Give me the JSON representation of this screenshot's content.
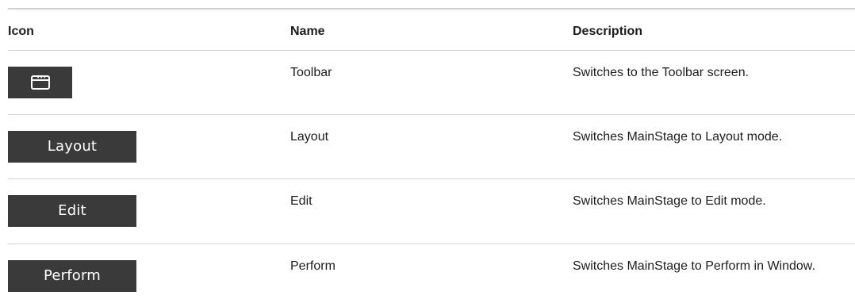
{
  "table": {
    "headers": {
      "icon": "Icon",
      "name": "Name",
      "description": "Description"
    },
    "rows": [
      {
        "icon_name": "toolbar-window-icon",
        "icon_label": "",
        "name": "Toolbar",
        "description": "Switches to the Toolbar screen."
      },
      {
        "icon_name": "layout-button-image",
        "icon_label": "Layout",
        "name": "Layout",
        "description": "Switches MainStage to Layout mode."
      },
      {
        "icon_name": "edit-button-image",
        "icon_label": "Edit",
        "name": "Edit",
        "description": "Switches MainStage to Edit mode."
      },
      {
        "icon_name": "perform-button-image",
        "icon_label": "Perform",
        "name": "Perform",
        "description": "Switches MainStage to Perform in Window."
      }
    ]
  },
  "colors": {
    "button_background": "#3a3a3a",
    "button_text": "#ffffff",
    "rule": "#d2d2d7",
    "text": "#1d1d1f"
  }
}
